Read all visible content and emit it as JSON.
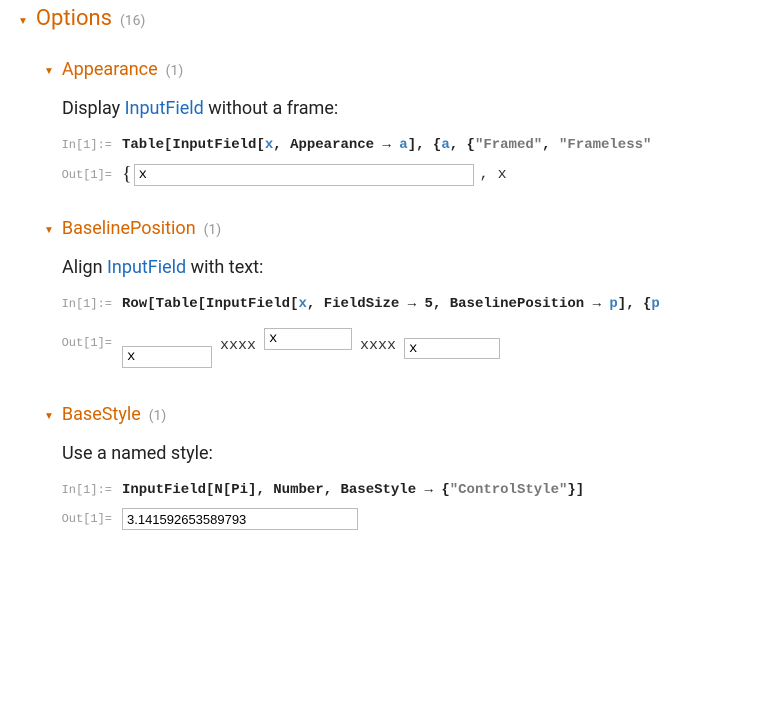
{
  "section": {
    "title": "Options",
    "count": "(16)"
  },
  "appearance": {
    "title": "Appearance",
    "count": "(1)",
    "desc_pre": "Display ",
    "desc_link": "InputField",
    "desc_post": " without a frame:",
    "in_label": "In[1]:=",
    "out_label": "Out[1]=",
    "code": {
      "p1": "Table",
      "p2": "[",
      "p3": "InputField",
      "p4": "[",
      "p5": "x",
      "p6": ", ",
      "p7": "Appearance",
      "p8": " → ",
      "p9": "a",
      "p10": "]",
      "p11": ", ",
      "p12": "{",
      "p13": "a",
      "p14": ", ",
      "p15": "{",
      "p16": "\"Framed\"",
      "p17": ", ",
      "p18": "\"Frameless\""
    },
    "out": {
      "brace": "{",
      "val1": "x",
      "sep": ",  x"
    }
  },
  "baseline": {
    "title": "BaselinePosition",
    "count": "(1)",
    "desc_pre": "Align ",
    "desc_link": "InputField",
    "desc_post": " with text:",
    "in_label": "In[1]:=",
    "out_label": "Out[1]=",
    "code": {
      "p1": "Row",
      "p2": "[",
      "p3": "Table",
      "p4": "[",
      "p5": "InputField",
      "p6": "[",
      "p7": "x",
      "p8": ", ",
      "p9": "FieldSize",
      "p10": " → ",
      "p11": "5",
      "p12": ", ",
      "p13": "BaselinePosition",
      "p14": " → ",
      "p15": "p",
      "p16": "]",
      "p17": ", ",
      "p18": "{",
      "p19": "p"
    },
    "out": {
      "f1": "x",
      "xxxx": " xxxx ",
      "f2": "x",
      "f3": "x"
    }
  },
  "basestyle": {
    "title": "BaseStyle",
    "count": "(1)",
    "desc": "Use a named style:",
    "in_label": "In[1]:=",
    "out_label": "Out[1]=",
    "code": {
      "p1": "InputField",
      "p2": "[",
      "p3": "N",
      "p4": "[",
      "p5": "Pi",
      "p6": "]",
      "p7": ", ",
      "p8": "Number",
      "p9": ", ",
      "p10": "BaseStyle",
      "p11": " → ",
      "p12": "{",
      "p13": "\"ControlStyle\"",
      "p14": "}",
      "p15": "]"
    },
    "out_val": "3.141592653589793"
  }
}
